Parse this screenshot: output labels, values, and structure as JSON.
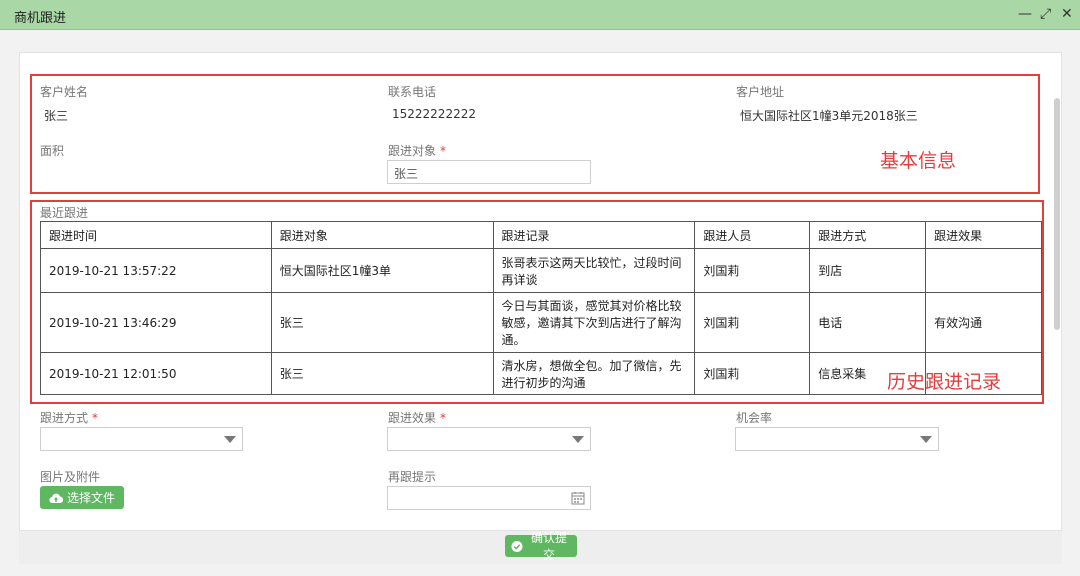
{
  "window": {
    "title": "商机跟进",
    "minimize": "—",
    "maximize": "⤢",
    "close": "✕"
  },
  "basic": {
    "customer_name_label": "客户姓名",
    "customer_name": "张三",
    "phone_label": "联系电话",
    "phone": "15222222222",
    "address_label": "客户地址",
    "address": "恒大国际社区1幢3单元2018张三",
    "area_label": "面积",
    "followup_target_label": "跟进对象",
    "followup_target_value": "张三",
    "annotation": "基本信息"
  },
  "history": {
    "section_label": "最近跟进",
    "annotation": "历史跟进记录",
    "columns": [
      "跟进时间",
      "跟进对象",
      "跟进记录",
      "跟进人员",
      "跟进方式",
      "跟进效果"
    ],
    "rows": [
      [
        "2019-10-21 13:57:22",
        "恒大国际社区1幢3单",
        "张哥表示这两天比较忙，过段时间再详谈",
        "刘国莉",
        "到店",
        ""
      ],
      [
        "2019-10-21 13:46:29",
        "张三",
        "今日与其面谈，感觉其对价格比较敏感，邀请其下次到店进行了解沟通。",
        "刘国莉",
        "电话",
        "有效沟通"
      ],
      [
        "2019-10-21 12:01:50",
        "张三",
        "清水房，想做全包。加了微信，先进行初步的沟通",
        "刘国莉",
        "信息采集",
        ""
      ]
    ]
  },
  "form": {
    "method_label": "跟进方式",
    "effect_label": "跟进效果",
    "chance_label": "机会率",
    "attach_label": "图片及附件",
    "choose_file": "选择文件",
    "reminder_label": "再跟提示",
    "submit": "确认提交"
  },
  "colors": {
    "titlebar": "#a9d8a6",
    "accent": "#5fb861",
    "annotation": "#e33d3d"
  }
}
